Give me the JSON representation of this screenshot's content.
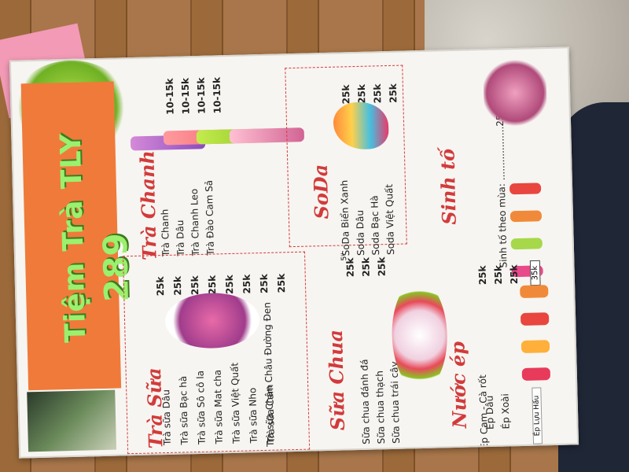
{
  "shop": {
    "name": "Tiệm Trà TLY",
    "number": "289"
  },
  "tra_chanh": {
    "title": "Trà Chanh",
    "items": [
      {
        "name": "Trà Chanh",
        "price": "10-15k"
      },
      {
        "name": "Trà Dâu",
        "price": "10-15k"
      },
      {
        "name": "Trà Chanh Leo",
        "price": "10-15k"
      },
      {
        "name": "Trà Đào Cam Sả",
        "price": "10-15k"
      }
    ]
  },
  "tra_sua": {
    "title": "Trà Sữa",
    "items": [
      {
        "name": "Trà sữa Dâu",
        "price": "25k"
      },
      {
        "name": "Trà sữa Bạc hà",
        "price": "25k"
      },
      {
        "name": "Trà sữa Sô cô la",
        "price": "25k"
      },
      {
        "name": "Trà sữa Mat cha",
        "price": "25k"
      },
      {
        "name": "Trà sữa Việt Quất",
        "price": "25k"
      },
      {
        "name": "Trà sữa Nho",
        "price": "25k"
      },
      {
        "name": "Trà sữa Cam",
        "price": "25k"
      },
      {
        "name": "Trà sữa Chân Châu Đường Đen",
        "price": "25k"
      }
    ]
  },
  "soda": {
    "title": "SoDa",
    "items": [
      {
        "name": "SoDa Biển Xanh",
        "price": "25k"
      },
      {
        "name": "Soda Dâu",
        "price": "25k"
      },
      {
        "name": "Soda Bạc Hà",
        "price": "25k"
      },
      {
        "name": "Soda Việt Quất",
        "price": "25k"
      }
    ]
  },
  "sua_chua": {
    "title": "Sữa Chua",
    "items": [
      {
        "name": "Sữa chua đánh đá",
        "price": "25k",
        "note": "5ᵁ"
      },
      {
        "name": "Sữa chua thạch",
        "price": "25k"
      },
      {
        "name": "Sữa chua trái cây",
        "price": "25k"
      }
    ]
  },
  "sinh_to": {
    "title": "Sinh tố",
    "items": [
      {
        "name": "Sinh tố theo mùa: ..................25k"
      }
    ]
  },
  "nuoc_ep": {
    "title": "Nước ép",
    "items": [
      {
        "name": "Ép Cam - Cà rốt",
        "price": "25k"
      },
      {
        "name": "Ép Dâu",
        "price": "25k"
      },
      {
        "name": "Ép Xoài",
        "price": "25k",
        "note": "35k"
      }
    ],
    "handwritten": "Ép Lựu Hấu"
  },
  "colors": {
    "accent": "#d23b3b",
    "band": "#f07a3a",
    "title": "#9bf06e"
  }
}
